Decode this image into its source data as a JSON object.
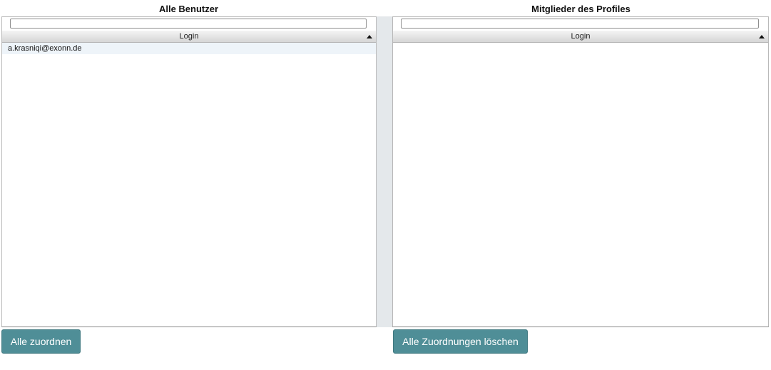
{
  "left_panel": {
    "title": "Alle Benutzer",
    "filter_value": "",
    "column_header": "Login",
    "rows": [
      "a.krasniqi@exonn.de"
    ],
    "button_label": "Alle zuordnen"
  },
  "right_panel": {
    "title": "Mitglieder des Profiles",
    "filter_value": "",
    "column_header": "Login",
    "rows": [],
    "button_label": "Alle Zuordnungen löschen"
  },
  "colors": {
    "button_bg": "#4f8e97",
    "selected_row_bg": "#eef4f9",
    "divider_bg": "#e4e8eb"
  },
  "icons": {
    "sort": "sort-ascending-icon"
  }
}
